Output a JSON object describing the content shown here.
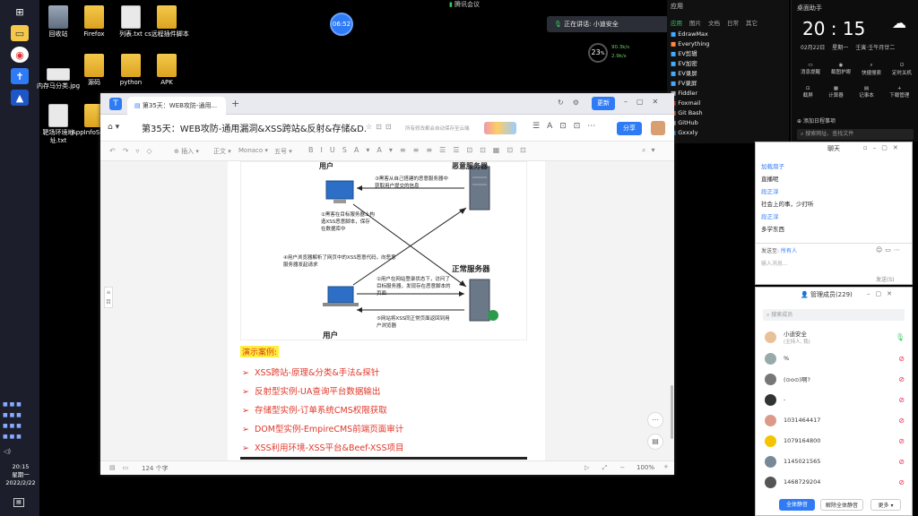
{
  "taskbar": {
    "clock_time": "20:15",
    "clock_day": "星期一",
    "clock_date": "2022/2/22"
  },
  "desktop": {
    "icons": [
      {
        "label": "回收站"
      },
      {
        "label": "Firefox"
      },
      {
        "label": "列表.txt"
      },
      {
        "label": "cs远程插件脚本"
      },
      {
        "label": "内存马分类.jpg"
      },
      {
        "label": "源码"
      },
      {
        "label": "python"
      },
      {
        "label": "APK"
      },
      {
        "label": "靶场环境地址.txt"
      },
      {
        "label": "AppInfoScanner"
      }
    ],
    "timer": "06:52",
    "meeting_app": "腾讯会议",
    "speaking": "正在讲话: 小迪安全"
  },
  "tencent_panel": {
    "tabs": [
      "应用",
      "图片",
      "文档",
      "日常",
      "其它"
    ],
    "apps": [
      "EdrawMax",
      "Everything",
      "EV剪辑",
      "EV加密",
      "EV录屏",
      "FV录屏",
      "Fiddler",
      "Foxmail",
      "Git Bash",
      "GitHub",
      "Gxxxly"
    ],
    "speed_value": "23",
    "speed_unit": "%",
    "up_speed": "90.3k/s",
    "down_speed": "2.9k/s"
  },
  "clock_panel": {
    "title": "桌面助手",
    "time": "20 : 15",
    "date": "02月22日",
    "weekday": "星期一",
    "lunar": "壬寅·壬午月廿二",
    "actions_row1": [
      "消息提醒",
      "截图护眼",
      "快捷搜索",
      "定时关机"
    ],
    "actions_row2": [
      "截屏",
      "计算器",
      "记事本",
      "下载管理"
    ],
    "add_todo": "添加日程事项",
    "search_placeholder": "搜索网址、查找文件"
  },
  "chat": {
    "title": "聊天",
    "messages": [
      {
        "name": "加载扇子",
        "text": "直播呢"
      },
      {
        "name": "段正淳",
        "text": "社会上的事，少打听"
      },
      {
        "name": "段正淳",
        "text": "多学东西"
      }
    ],
    "send_to_label": "发送至:",
    "send_to_value": "所有人",
    "input_placeholder": "输入消息...",
    "send_button": "发送(S)"
  },
  "members": {
    "title": "管理成员(229)",
    "search_placeholder": "搜索成员",
    "list": [
      {
        "name": "小迪安全",
        "sub": "(主持人, 我)",
        "color": "#e8c19a"
      },
      {
        "name": "%",
        "sub": "",
        "color": "#9aa"
      },
      {
        "name": "(⊙o⊙)啊?",
        "sub": "",
        "color": "#777"
      },
      {
        "name": "-",
        "sub": "",
        "color": "#333"
      },
      {
        "name": "1031464417",
        "sub": "",
        "color": "#d98"
      },
      {
        "name": "1079164800",
        "sub": "",
        "color": "#f5c400"
      },
      {
        "name": "1145021565",
        "sub": "",
        "color": "#789"
      },
      {
        "name": "1468729204",
        "sub": "",
        "color": "#555"
      }
    ],
    "mute_all": "全体静音",
    "unmute_all": "解除全体静音",
    "more": "更多"
  },
  "browser": {
    "tab_title": "第35天：WEB攻防-通用...",
    "doc_title": "第35天：WEB攻防-通用漏洞&XSS跨站&反射&存储&D...",
    "saved_note": "所有修改都会自动保存至云端",
    "update_button": "更新",
    "share_button": "分享",
    "toolbar_insert": "插入",
    "toolbar_text": "正文",
    "toolbar_font": "Monaco",
    "toolbar_size": "五号",
    "status_words": "124 个字",
    "zoom": "100%",
    "diagram": {
      "top_label": "用户",
      "top_label_right": "恶意服务器",
      "server_label": "正常服务器",
      "user_label": "用户",
      "step3": "③黑客从自己搭建的恶意服务器中获取用户提交的信息",
      "step1": "①黑客在目标服务器上构造XSS恶意脚本，保存在数据库中",
      "step4": "④用户浏览器解析了网页中的XSS恶意代码，向恶意服务器发起请求",
      "step2": "②用户在网站登录状态下，访问了目标服务器，发现存在恶意脚本的页面",
      "step5": "⑤网站将XSS同正常页面返回到用户浏览器"
    },
    "demo_heading": "演示案例:",
    "cases": [
      "XSS跨站-原理&分类&手法&探针",
      "反射型实例-UA查询平台数据输出",
      "存储型实例-订单系统CMS权限获取",
      "DOM型实例-EmpireCMS前端页面审计",
      "XSS利用环境-XSS平台&Beef-XSS项目"
    ]
  },
  "colors": {
    "accent": "#2f7bf5",
    "case_red": "#e0382b",
    "highlight": "#ffef3a",
    "taskbar": "#1c1f2b"
  }
}
